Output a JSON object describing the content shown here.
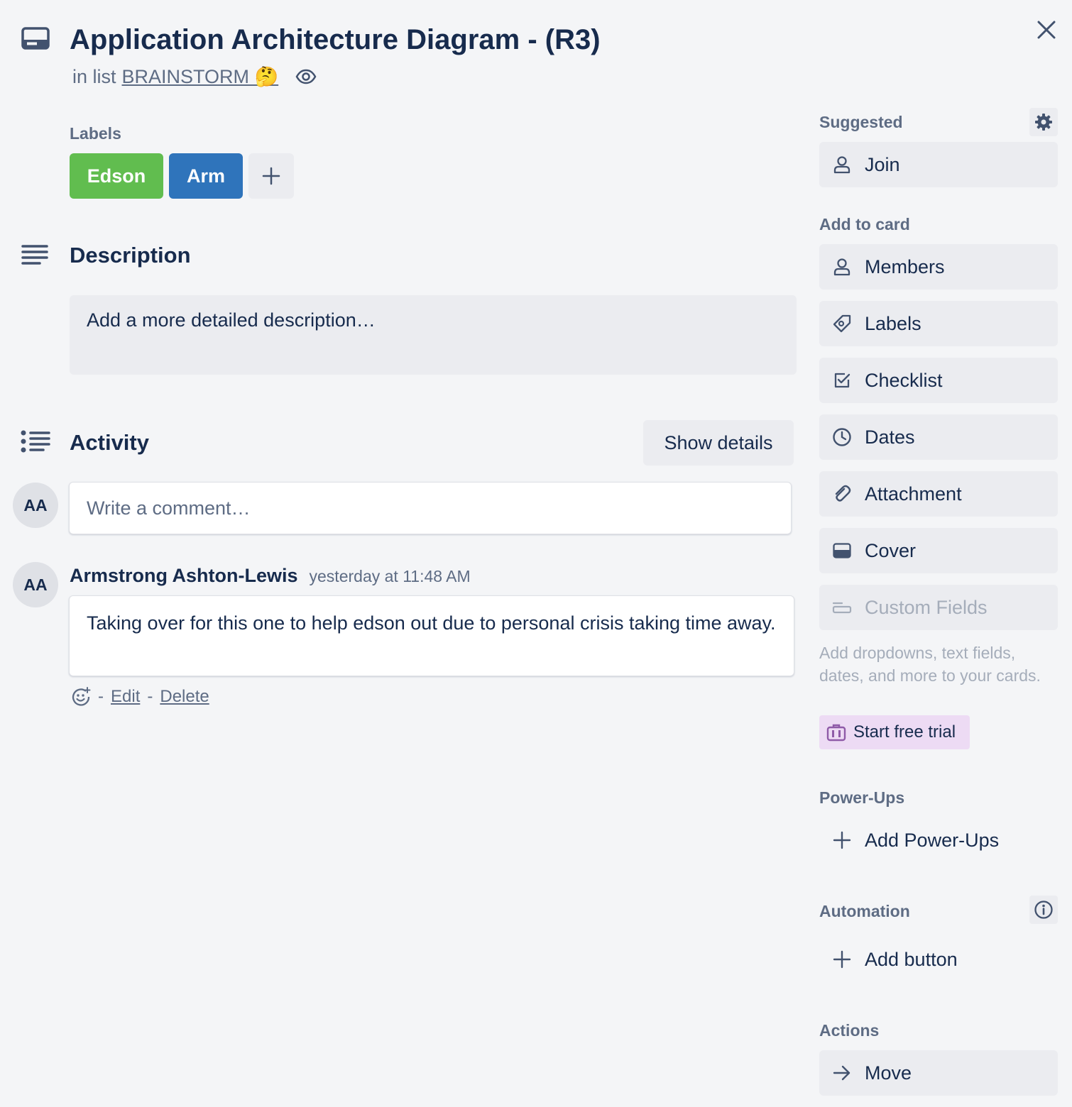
{
  "card": {
    "title": "Application Architecture Diagram - (R3)",
    "list_prefix": "in list",
    "list_name": "BRAINSTORM 🤔"
  },
  "labels": {
    "heading": "Labels",
    "items": [
      {
        "name": "Edson",
        "color": "#61bd4f"
      },
      {
        "name": "Arm",
        "color": "#2f74bb"
      }
    ]
  },
  "description": {
    "heading": "Description",
    "placeholder": "Add a more detailed description…"
  },
  "activity": {
    "heading": "Activity",
    "show_details": "Show details",
    "comment_placeholder": "Write a comment…",
    "current_user_initials": "AA",
    "comments": [
      {
        "initials": "AA",
        "author": "Armstrong Ashton-Lewis",
        "time": "yesterday at 11:48 AM",
        "text": "Taking over for this one to help edson out due to personal crisis taking time away.",
        "sep": "-",
        "edit": "Edit",
        "delete": "Delete"
      }
    ]
  },
  "sidebar": {
    "suggested": {
      "heading": "Suggested",
      "join": "Join"
    },
    "add_to_card": {
      "heading": "Add to card",
      "members": "Members",
      "labels": "Labels",
      "checklist": "Checklist",
      "dates": "Dates",
      "attachment": "Attachment",
      "cover": "Cover",
      "custom_fields": "Custom Fields",
      "custom_fields_desc": "Add dropdowns, text fields, dates, and more to your cards.",
      "free_trial": "Start free trial"
    },
    "power_ups": {
      "heading": "Power-Ups",
      "add": "Add Power-Ups"
    },
    "automation": {
      "heading": "Automation",
      "add": "Add button"
    },
    "actions": {
      "heading": "Actions",
      "move": "Move"
    }
  },
  "colors": {
    "background": "#f4f5f7",
    "text": "#172b4d",
    "muted": "#5e6c84",
    "button_bg": "#ebecf0",
    "trial_bg": "#eddbf4"
  }
}
